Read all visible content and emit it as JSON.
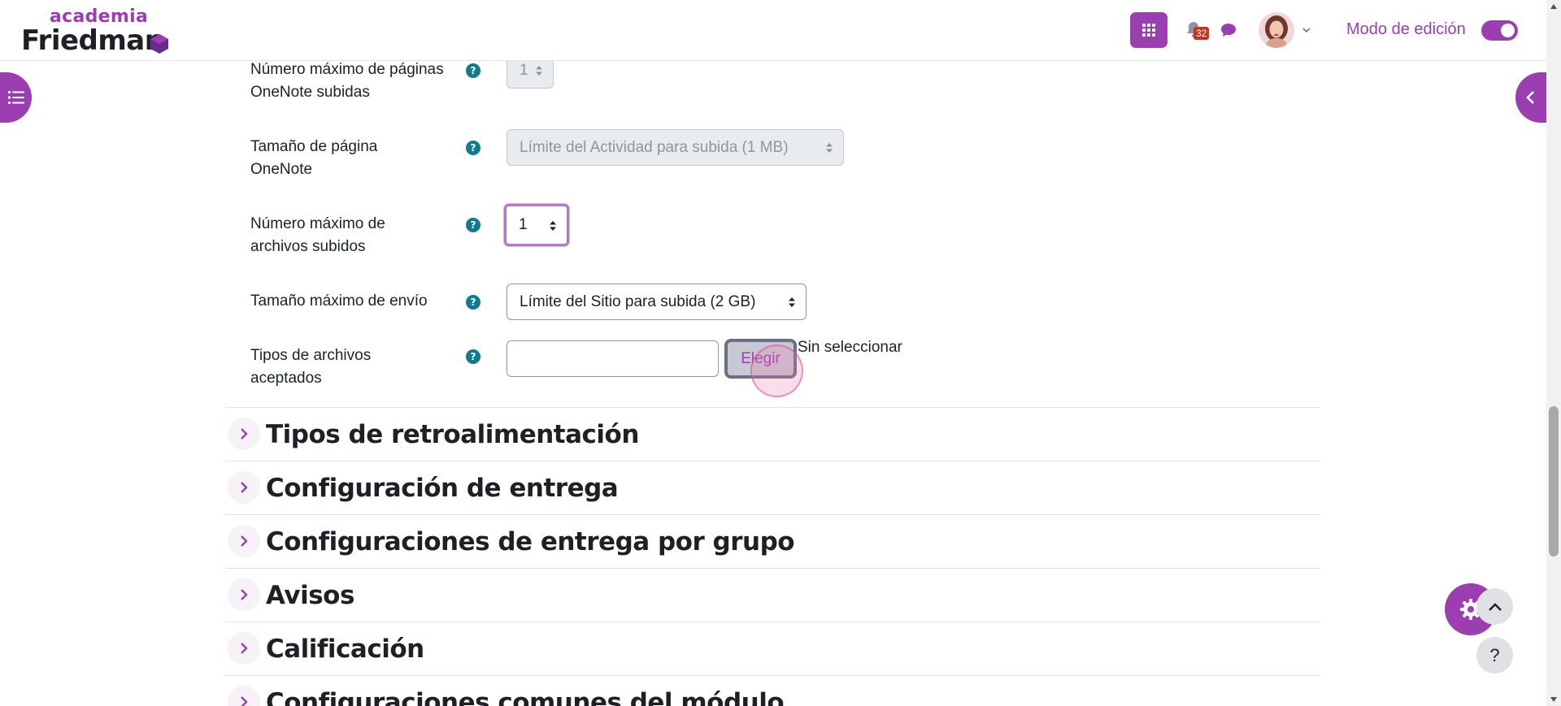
{
  "navbar": {
    "logo_top": "academia",
    "logo_bottom": "Friedman",
    "notification_count": "32",
    "edit_mode_label": "Modo de edición",
    "edit_mode_on": true
  },
  "form": {
    "onenote_max_pages_label": "Número máximo de páginas OneNote subidas",
    "onenote_max_pages_value": "1",
    "onenote_page_size_label": "Tamaño de página OneNote",
    "onenote_page_size_value": "Límite del Actividad para subida (1 MB)",
    "max_files_label": "Número máximo de archivos subidos",
    "max_files_value": "1",
    "max_submission_size_label": "Tamaño máximo de envío",
    "max_submission_size_value": "Límite del Sitio para subida (2 GB)",
    "accepted_types_label": "Tipos de archivos aceptados",
    "accepted_types_value": "",
    "choose_button": "Elegir",
    "none_selected": "Sin seleccionar"
  },
  "sections": [
    {
      "title": "Tipos de retroalimentación"
    },
    {
      "title": "Configuración de entrega"
    },
    {
      "title": "Configuraciones de entrega por grupo"
    },
    {
      "title": "Avisos"
    },
    {
      "title": "Calificación"
    },
    {
      "title": "Configuraciones comunes del módulo"
    }
  ],
  "floating": {
    "help_label": "?"
  },
  "colors": {
    "brand": "#9b3fb0",
    "help_icon": "#0f7b8c",
    "badge": "#ca3120"
  }
}
